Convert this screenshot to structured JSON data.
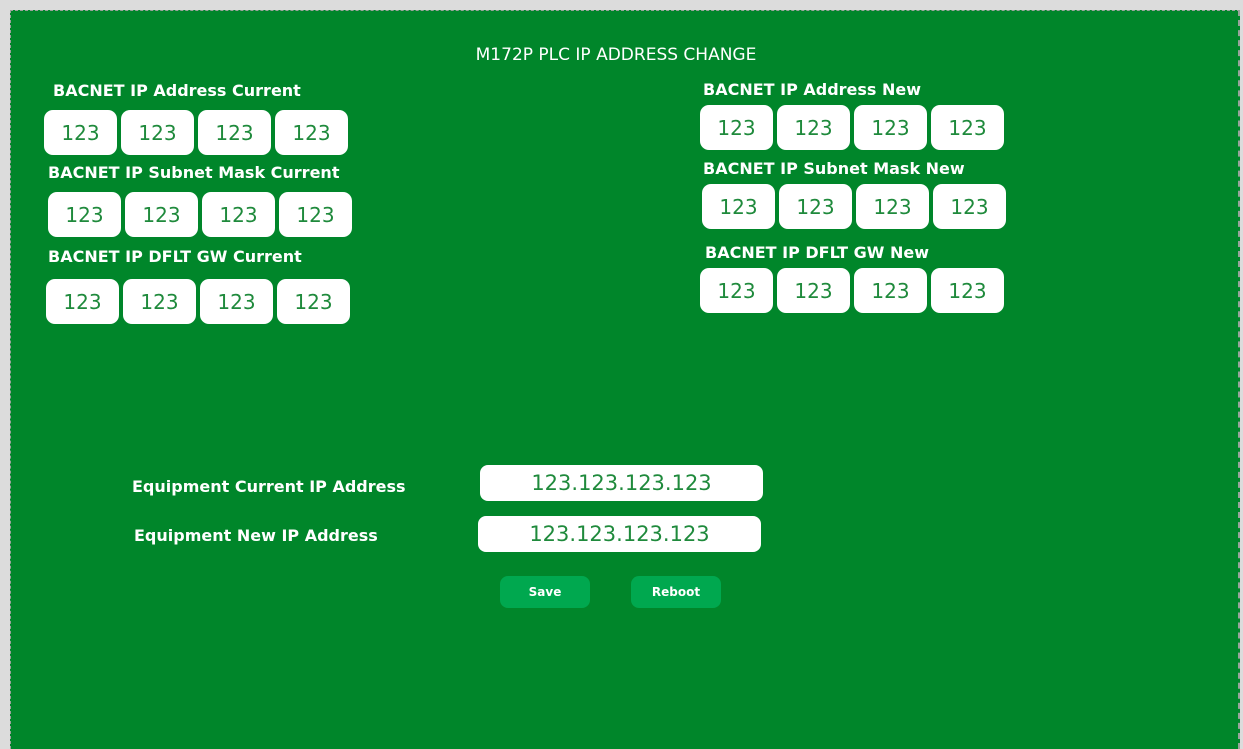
{
  "page": {
    "title": "M172P PLC IP ADDRESS CHANGE"
  },
  "current": {
    "ip_label": "BACNET IP Address Current",
    "ip": [
      "123",
      "123",
      "123",
      "123"
    ],
    "subnet_label": "BACNET IP Subnet Mask Current",
    "subnet": [
      "123",
      "123",
      "123",
      "123"
    ],
    "gw_label": "BACNET IP DFLT GW Current",
    "gw": [
      "123",
      "123",
      "123",
      "123"
    ]
  },
  "new": {
    "ip_label": "BACNET IP Address New",
    "ip": [
      "123",
      "123",
      "123",
      "123"
    ],
    "subnet_label": "BACNET IP Subnet Mask New",
    "subnet": [
      "123",
      "123",
      "123",
      "123"
    ],
    "gw_label": "BACNET IP DFLT GW New",
    "gw": [
      "123",
      "123",
      "123",
      "123"
    ]
  },
  "equipment": {
    "current_label": "Equipment Current IP Address",
    "current_value": "123.123.123.123",
    "new_label": "Equipment New IP Address",
    "new_value": "123.123.123.123"
  },
  "actions": {
    "save_label": "Save",
    "reboot_label": "Reboot"
  },
  "colors": {
    "background": "#00862a",
    "field": "#ffffff",
    "field_text": "#1f8a3c",
    "button": "#00a84f"
  }
}
